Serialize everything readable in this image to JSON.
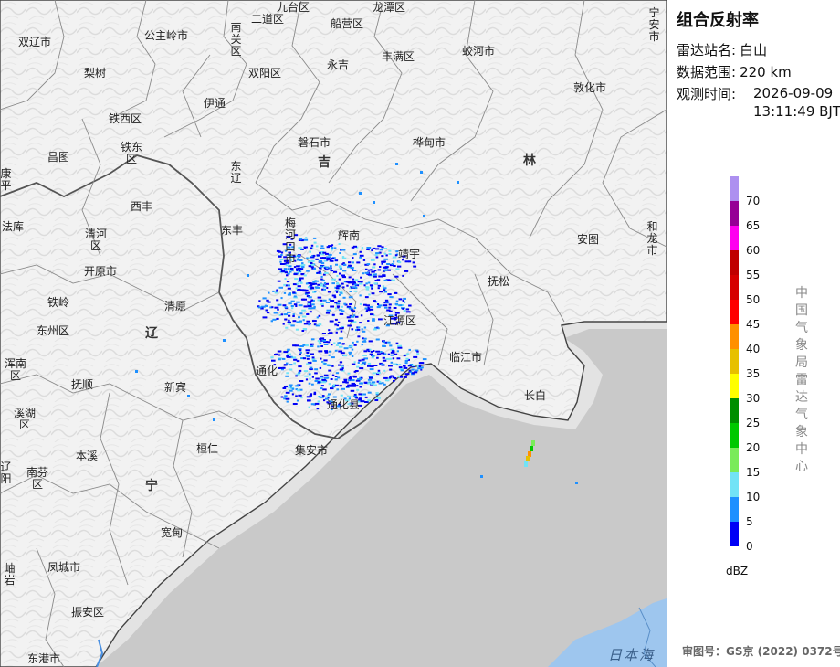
{
  "panel": {
    "title": "组合反射率",
    "station_label": "雷达站名:",
    "station_value": "白山",
    "range_label": "数据范围:",
    "range_value": "220 km",
    "time_label": "观测时间:",
    "time_value": "2026-09-09 13:11:49 BJT",
    "unit": "dBZ",
    "agency": "中国气象局雷达气象中心",
    "approval": "审图号：GS京 (2022) 0372号"
  },
  "legend": [
    {
      "label": "70",
      "color": "#ad90f0"
    },
    {
      "label": "65",
      "color": "#960096"
    },
    {
      "label": "60",
      "color": "#ff00f0"
    },
    {
      "label": "55",
      "color": "#c00000"
    },
    {
      "label": "50",
      "color": "#d60000"
    },
    {
      "label": "45",
      "color": "#ff0000"
    },
    {
      "label": "40",
      "color": "#ff9000"
    },
    {
      "label": "35",
      "color": "#e7c000"
    },
    {
      "label": "30",
      "color": "#ffff00"
    },
    {
      "label": "25",
      "color": "#008e00"
    },
    {
      "label": "20",
      "color": "#00c800"
    },
    {
      "label": "15",
      "color": "#7aeb5a"
    },
    {
      "label": "10",
      "color": "#72e3f6"
    },
    {
      "label": "5",
      "color": "#1e90ff"
    },
    {
      "label": "0",
      "color": "#0000f6"
    }
  ],
  "map": {
    "cities": [
      {
        "id": "jiutai",
        "name": "九台区"
      },
      {
        "id": "longtan",
        "name": "龙潭区"
      },
      {
        "id": "erdaodao",
        "name": "二道区"
      },
      {
        "id": "chuanying",
        "name": "船营区"
      },
      {
        "id": "ningan",
        "name": "宁安市"
      },
      {
        "id": "shuangliao",
        "name": "双辽市"
      },
      {
        "id": "gongzhuling",
        "name": "公主岭市"
      },
      {
        "id": "nanguan",
        "name": "南关区"
      },
      {
        "id": "shuangyang",
        "name": "双阳区"
      },
      {
        "id": "yongji",
        "name": "永吉"
      },
      {
        "id": "fengman",
        "name": "丰满区"
      },
      {
        "id": "jiaohe",
        "name": "蛟河市"
      },
      {
        "id": "lishu",
        "name": "梨树"
      },
      {
        "id": "yitong",
        "name": "伊通"
      },
      {
        "id": "dunhua",
        "name": "敦化市"
      },
      {
        "id": "tiexi",
        "name": "铁西区"
      },
      {
        "id": "tiedong",
        "name": "铁东区"
      },
      {
        "id": "changtu",
        "name": "昌图"
      },
      {
        "id": "dongliao",
        "name": "东辽"
      },
      {
        "id": "panshi",
        "name": "磐石市"
      },
      {
        "id": "huadian",
        "name": "桦甸市"
      },
      {
        "id": "kangping",
        "name": "康平"
      },
      {
        "id": "xifeng",
        "name": "西丰"
      },
      {
        "id": "dongfeng",
        "name": "东丰"
      },
      {
        "id": "meihekou",
        "name": "梅河口市"
      },
      {
        "id": "huinan",
        "name": "辉南"
      },
      {
        "id": "jingyu",
        "name": "靖宇"
      },
      {
        "id": "antu",
        "name": "安图"
      },
      {
        "id": "helong",
        "name": "和龙市"
      },
      {
        "id": "faku",
        "name": "法库"
      },
      {
        "id": "qinghe",
        "name": "清河区"
      },
      {
        "id": "kaiyuan",
        "name": "开原市"
      },
      {
        "id": "fusong",
        "name": "抚松"
      },
      {
        "id": "tieling",
        "name": "铁岭"
      },
      {
        "id": "qingyuan",
        "name": "清原"
      },
      {
        "id": "jiangyuan",
        "name": "江源区"
      },
      {
        "id": "dongzhou",
        "name": "东州区"
      },
      {
        "id": "hunnan",
        "name": "浑南区"
      },
      {
        "id": "linjiang",
        "name": "临江市"
      },
      {
        "id": "fushun",
        "name": "抚顺"
      },
      {
        "id": "xinbin",
        "name": "新宾"
      },
      {
        "id": "tonghua",
        "name": "通化"
      },
      {
        "id": "tonghuaxian",
        "name": "通化县"
      },
      {
        "id": "changbai",
        "name": "长白"
      },
      {
        "id": "xihu",
        "name": "溪湖区"
      },
      {
        "id": "huanren",
        "name": "桓仁"
      },
      {
        "id": "benxi",
        "name": "本溪"
      },
      {
        "id": "ji_an",
        "name": "集安市"
      },
      {
        "id": "liaoyang",
        "name": "辽阳"
      },
      {
        "id": "nanfen",
        "name": "南芬区"
      },
      {
        "id": "kuandian",
        "name": "宽甸"
      },
      {
        "id": "xiuyan",
        "name": "岫岩"
      },
      {
        "id": "fengcheng",
        "name": "凤城市"
      },
      {
        "id": "zhenan",
        "name": "振安区"
      },
      {
        "id": "donggang",
        "name": "东港市"
      }
    ],
    "provinces": [
      {
        "id": "ji",
        "name": "吉"
      },
      {
        "id": "lin",
        "name": "林"
      },
      {
        "id": "liao",
        "name": "辽"
      },
      {
        "id": "ning",
        "name": "宁"
      }
    ],
    "sea": "日本海"
  }
}
